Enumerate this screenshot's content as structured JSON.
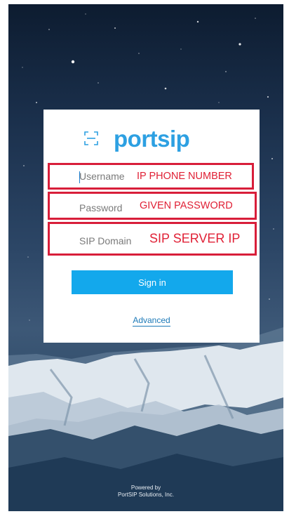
{
  "login": {
    "logo_text": "portsip",
    "username_placeholder": "Username",
    "password_placeholder": "Password",
    "domain_placeholder": "SIP Domain",
    "signin_label": "Sign in",
    "advanced_label": "Advanced"
  },
  "annotations": {
    "username_note": "IP PHONE NUMBER",
    "password_note": "GIVEN PASSWORD",
    "domain_note": "SIP SERVER IP",
    "highlight_color": "#d81e3a"
  },
  "footer": {
    "line1": "Powered by",
    "line2": "PortSIP Solutions, Inc."
  },
  "colors": {
    "accent": "#13a8ec",
    "brand": "#2da0e2",
    "link": "#1d7ab8"
  },
  "icons": {
    "scan": "qr-scan-icon"
  }
}
